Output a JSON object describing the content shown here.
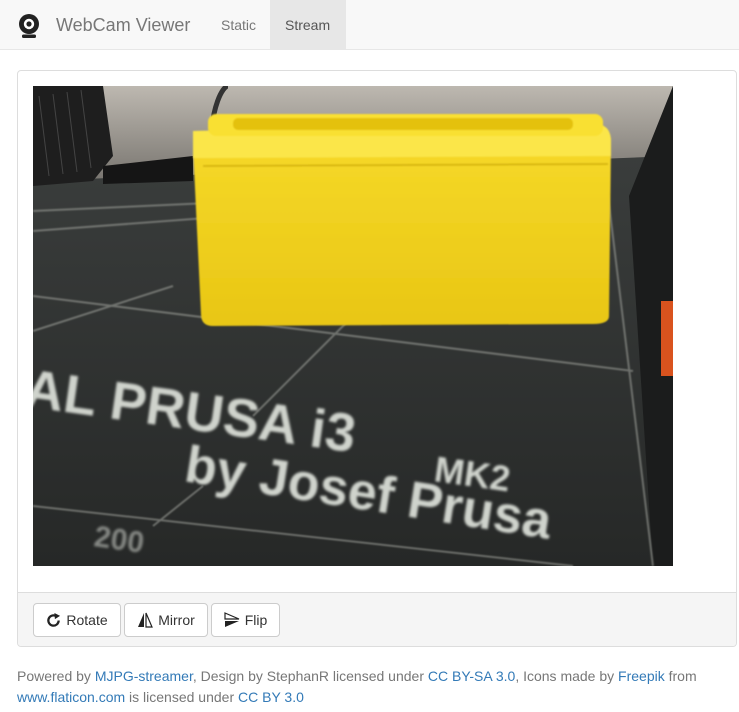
{
  "navbar": {
    "brand_icon": "webcam-icon",
    "brand_title": "WebCam Viewer",
    "links": [
      {
        "label": "Static",
        "active": false
      },
      {
        "label": "Stream",
        "active": true
      }
    ]
  },
  "stream": {
    "alt": "webcam stream",
    "bed_text_line1": "AL PRUSA i3",
    "bed_text_mk": "MK2",
    "bed_text_line2": "by Josef Prusa",
    "bed_text_scale": "200"
  },
  "controls": {
    "rotate": {
      "label": "Rotate",
      "icon": "rotate-icon"
    },
    "mirror": {
      "label": "Mirror",
      "icon": "mirror-icon"
    },
    "flip": {
      "label": "Flip",
      "icon": "flip-icon"
    }
  },
  "footer": {
    "powered_by": "Powered by ",
    "mjpg_link": "MJPG-streamer",
    "design_by": ", Design by StephanR licensed under ",
    "ccbysa_link": "CC BY-SA 3.0",
    "icons_made_by": ", Icons made by ",
    "freepik_link": "Freepik",
    "from": " from",
    "flaticon_link": "www.flaticon.com",
    "licensed_under": " is licensed under ",
    "ccby_link": "CC BY 3.0"
  },
  "colors": {
    "link": "#337ab7",
    "bed": "#2b2e2d",
    "print_yellow": "#f2d21b"
  }
}
